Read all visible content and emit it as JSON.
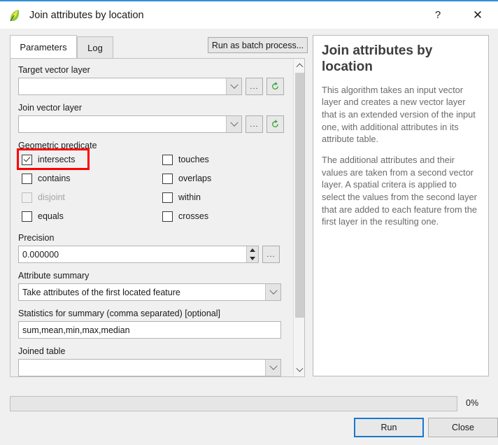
{
  "window": {
    "title": "Join attributes by location",
    "logo_icon": "qgis-leaf-logo",
    "help_icon": "?",
    "close_icon": "✕"
  },
  "tabs": [
    {
      "label": "Parameters",
      "active": true
    },
    {
      "label": "Log",
      "active": false
    }
  ],
  "toolbar": {
    "batch_label": "Run as batch process..."
  },
  "parameters": {
    "target_layer": {
      "label": "Target vector layer",
      "value": "",
      "browse_label": "...",
      "refresh_icon": "refresh-icon"
    },
    "join_layer": {
      "label": "Join vector layer",
      "value": "",
      "browse_label": "...",
      "refresh_icon": "refresh-icon"
    },
    "geometric_predicate": {
      "label": "Geometric predicate",
      "options": [
        {
          "label": "intersects",
          "checked": true,
          "disabled": false,
          "highlighted": true
        },
        {
          "label": "touches",
          "checked": false,
          "disabled": false,
          "highlighted": false
        },
        {
          "label": "contains",
          "checked": false,
          "disabled": false,
          "highlighted": false
        },
        {
          "label": "overlaps",
          "checked": false,
          "disabled": false,
          "highlighted": false
        },
        {
          "label": "disjoint",
          "checked": false,
          "disabled": true,
          "highlighted": false
        },
        {
          "label": "within",
          "checked": false,
          "disabled": false,
          "highlighted": false
        },
        {
          "label": "equals",
          "checked": false,
          "disabled": false,
          "highlighted": false
        },
        {
          "label": "crosses",
          "checked": false,
          "disabled": false,
          "highlighted": false
        }
      ]
    },
    "precision": {
      "label": "Precision",
      "value": "0.000000",
      "browse_label": "..."
    },
    "attribute_summary": {
      "label": "Attribute summary",
      "value": "Take attributes of the first located feature"
    },
    "statistics": {
      "label": "Statistics for summary (comma separated) [optional]",
      "value": "sum,mean,min,max,median"
    },
    "joined_table": {
      "label": "Joined table",
      "value": ""
    }
  },
  "help": {
    "title": "Join attributes by location",
    "paragraphs": [
      "This algorithm takes an input vector layer and creates a new vector layer that is an extended version of the input one, with additional attributes in its attribute table.",
      "The additional attributes and their values are taken from a second vector layer. A spatial critera is applied to select the values from the second layer that are added to each feature from the first layer in the resulting one."
    ]
  },
  "footer": {
    "progress_percent": "0%",
    "run_label": "Run",
    "close_label": "Close"
  },
  "colors": {
    "accent": "#2f8fd8",
    "highlight": "#ff0000",
    "focus_border": "#1878cf"
  }
}
